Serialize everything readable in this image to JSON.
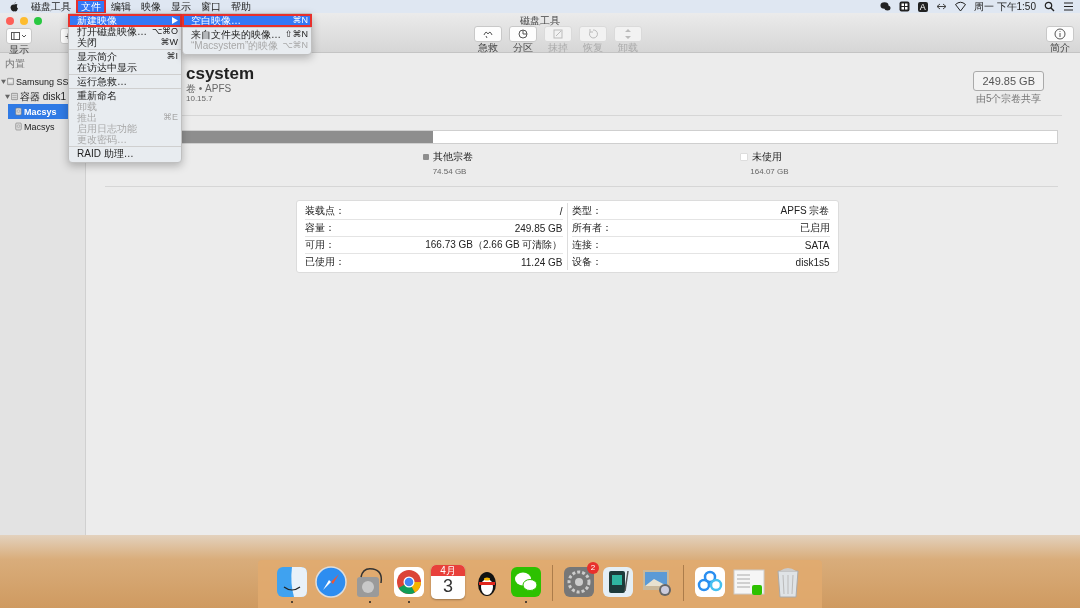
{
  "menubar": {
    "menus": [
      {
        "label": "磁盘工具",
        "selected": false,
        "annotated": false
      },
      {
        "label": "文件",
        "selected": true,
        "annotated": true
      },
      {
        "label": "编辑",
        "selected": false,
        "annotated": false
      },
      {
        "label": "映像",
        "selected": false,
        "annotated": false
      },
      {
        "label": "显示",
        "selected": false,
        "annotated": false
      },
      {
        "label": "窗口",
        "selected": false,
        "annotated": false
      },
      {
        "label": "帮助",
        "selected": false,
        "annotated": false
      }
    ],
    "input_method": "A",
    "clock": "周一 下午1:50"
  },
  "window": {
    "title": "磁盘工具",
    "view_label": "显示",
    "add": "+",
    "info_label": "简介",
    "tools": [
      {
        "label": "急救",
        "kind": "firstaid",
        "disabled": false
      },
      {
        "label": "分区",
        "kind": "partition",
        "disabled": false
      },
      {
        "label": "抹掉",
        "kind": "erase",
        "disabled": true
      },
      {
        "label": "恢复",
        "kind": "restore",
        "disabled": true
      },
      {
        "label": "卸载",
        "kind": "unmount",
        "disabled": true
      }
    ]
  },
  "sidebar": {
    "section": "内置",
    "items": [
      {
        "label": "Samsung SS",
        "kind": "disk",
        "selected": false,
        "expanded": true,
        "children": [
          {
            "label": "容器 disk1",
            "kind": "container",
            "selected": false,
            "expanded": true,
            "children": [
              {
                "label": "Macsys",
                "kind": "volume",
                "selected": true
              },
              {
                "label": "Macsys",
                "kind": "volume",
                "selected": false
              }
            ]
          }
        ]
      }
    ]
  },
  "volume": {
    "name": "csystem",
    "subtitle": "卷 • APFS",
    "version": "10.15.7",
    "capacity": "249.85 GB",
    "capacity_note": "由5个宗卷共享",
    "segments": [
      {
        "name": "其他宗卷",
        "size": "74.54 GB",
        "color": "#8e8e8e",
        "level": 0.344
      },
      {
        "name": "未使用",
        "size": "164.07 GB",
        "color": "#ffffff"
      }
    ]
  },
  "details": {
    "left": [
      {
        "label": "装载点：",
        "value": "/"
      },
      {
        "label": "容量：",
        "value": "249.85 GB"
      },
      {
        "label": "可用：",
        "value": "166.73 GB（2.66 GB 可清除）"
      },
      {
        "label": "已使用：",
        "value": "11.24 GB"
      }
    ],
    "right": [
      {
        "label": "类型：",
        "value": "APFS 宗卷"
      },
      {
        "label": "所有者：",
        "value": "已启用"
      },
      {
        "label": "连接：",
        "value": "SATA"
      },
      {
        "label": "设备：",
        "value": "disk1s5"
      }
    ]
  },
  "file_menu": {
    "items": [
      {
        "kind": "item",
        "label": "新建映像",
        "selected": true,
        "annotated": true,
        "disabled": false,
        "submenu": true
      },
      {
        "kind": "item",
        "label": "打开磁盘映像…",
        "shortcut": "⌥⌘O",
        "selected": false,
        "annotated": false,
        "disabled": false
      },
      {
        "kind": "item",
        "label": "关闭",
        "shortcut": "⌘W",
        "selected": false,
        "annotated": false,
        "disabled": false
      },
      {
        "kind": "separator"
      },
      {
        "kind": "item",
        "label": "显示简介",
        "shortcut": "⌘I",
        "selected": false,
        "annotated": false,
        "disabled": false
      },
      {
        "kind": "item",
        "label": "在访达中显示",
        "selected": false,
        "annotated": false,
        "disabled": false
      },
      {
        "kind": "separator"
      },
      {
        "kind": "item",
        "label": "运行急救…",
        "selected": false,
        "annotated": false,
        "disabled": false
      },
      {
        "kind": "separator"
      },
      {
        "kind": "item",
        "label": "重新命名",
        "selected": false,
        "annotated": false,
        "disabled": false
      },
      {
        "kind": "item",
        "label": "卸载",
        "selected": false,
        "annotated": false,
        "disabled": true
      },
      {
        "kind": "item",
        "label": "推出",
        "shortcut": "⌘E",
        "selected": false,
        "annotated": false,
        "disabled": true
      },
      {
        "kind": "item",
        "label": "启用日志功能",
        "selected": false,
        "annotated": false,
        "disabled": true
      },
      {
        "kind": "item",
        "label": "更改密码…",
        "selected": false,
        "annotated": false,
        "disabled": true
      },
      {
        "kind": "separator"
      },
      {
        "kind": "item",
        "label": "RAID 助理…",
        "selected": false,
        "annotated": false,
        "disabled": false
      }
    ]
  },
  "submenu": {
    "items": [
      {
        "kind": "item",
        "label": "空白映像…",
        "shortcut": "⌘N",
        "selected": true,
        "annotated": true,
        "disabled": false
      },
      {
        "kind": "separator"
      },
      {
        "kind": "item",
        "label": "来自文件夹的映像…",
        "shortcut": "⇧⌘N",
        "selected": false,
        "annotated": false,
        "disabled": false
      },
      {
        "kind": "item",
        "label": "“Macsystem”的映像",
        "shortcut": "⌥⌘N",
        "selected": false,
        "annotated": false,
        "disabled": true
      }
    ]
  },
  "dock": {
    "apps": [
      {
        "kind": "finder",
        "running": true
      },
      {
        "kind": "safari",
        "running": false
      },
      {
        "kind": "diskutility",
        "running": true
      },
      {
        "kind": "chrome",
        "running": true
      },
      {
        "kind": "calendar",
        "running": false,
        "month": "4月",
        "day": "3"
      },
      {
        "kind": "penguin",
        "running": false
      },
      {
        "kind": "wechat",
        "running": true
      },
      {
        "kind": "separator"
      },
      {
        "kind": "settings",
        "running": false,
        "badge": "2"
      },
      {
        "kind": "tablet",
        "running": false
      },
      {
        "kind": "preview",
        "running": false
      },
      {
        "kind": "separator"
      },
      {
        "kind": "cloud",
        "running": false
      },
      {
        "kind": "filewindow",
        "running": false
      },
      {
        "kind": "trash",
        "running": false
      }
    ]
  }
}
